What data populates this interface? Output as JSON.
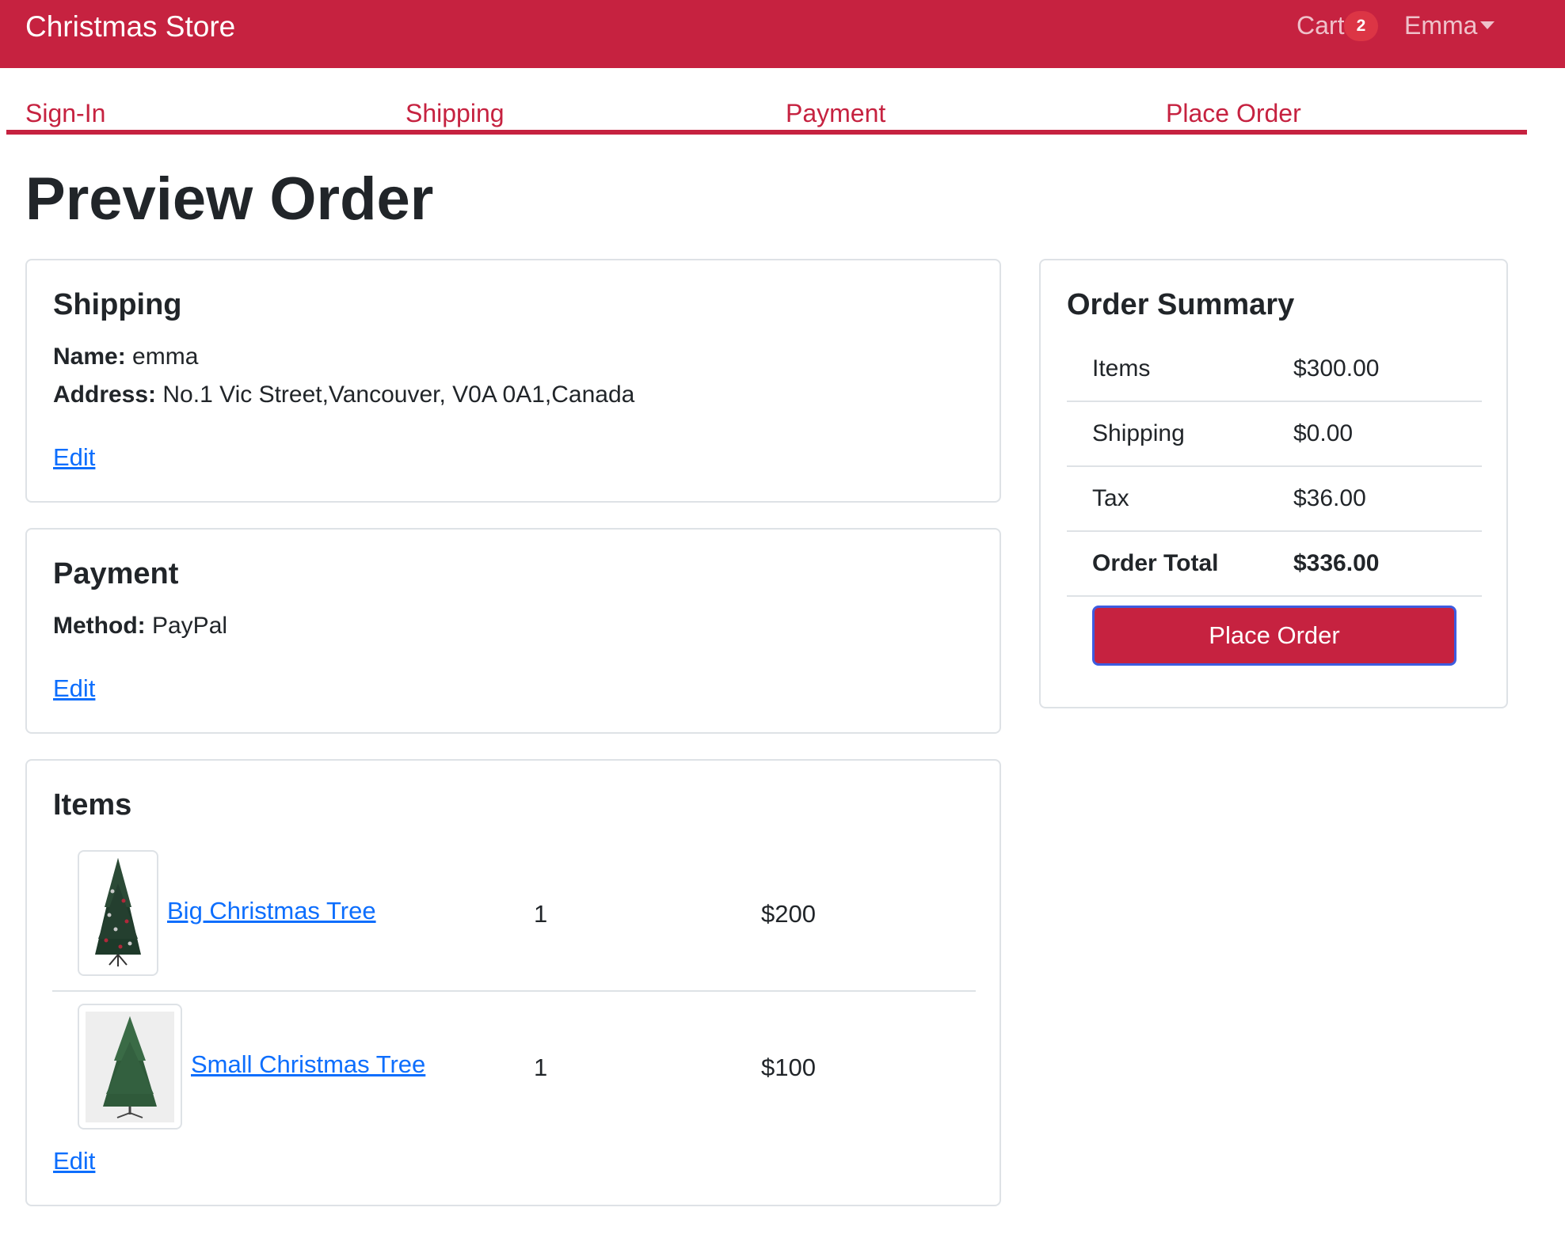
{
  "navbar": {
    "brand": "Christmas Store",
    "cart_label": "Cart",
    "cart_count": "2",
    "user_name": "Emma"
  },
  "steps": [
    "Sign-In",
    "Shipping",
    "Payment",
    "Place Order"
  ],
  "page_title": "Preview Order",
  "shipping": {
    "title": "Shipping",
    "name_label": "Name:",
    "name_value": "emma",
    "address_label": "Address:",
    "address_value": "No.1 Vic Street,Vancouver, V0A 0A1,Canada",
    "edit_label": "Edit"
  },
  "payment": {
    "title": "Payment",
    "method_label": "Method:",
    "method_value": "PayPal",
    "edit_label": "Edit"
  },
  "items": {
    "title": "Items",
    "list": [
      {
        "name": "Big Christmas Tree",
        "qty": "1",
        "price": "$200"
      },
      {
        "name": "Small Christmas Tree",
        "qty": "1",
        "price": "$100"
      }
    ],
    "edit_label": "Edit"
  },
  "summary": {
    "title": "Order Summary",
    "rows": [
      {
        "label": "Items",
        "value": "$300.00"
      },
      {
        "label": "Shipping",
        "value": "$0.00"
      },
      {
        "label": "Tax",
        "value": "$36.00"
      },
      {
        "label": "Order Total",
        "value": "$336.00"
      }
    ],
    "button_label": "Place Order"
  },
  "colors": {
    "brand_red": "#c62240",
    "link_blue": "#0d6efd",
    "badge_red": "#dc3545"
  }
}
